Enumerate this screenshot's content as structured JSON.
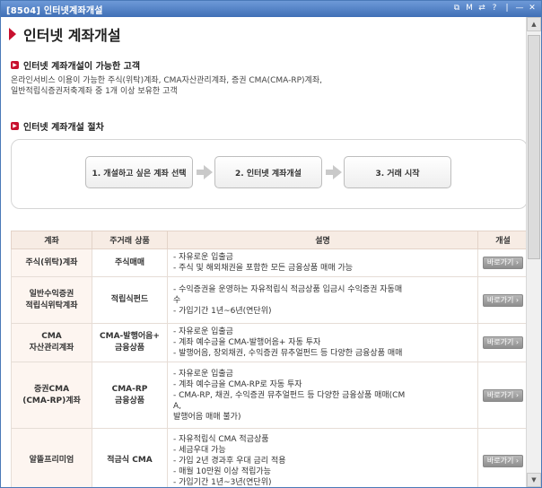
{
  "window": {
    "title": "[8504] 인터넷계좌개설",
    "controls": [
      "⧉",
      "M",
      "⇄",
      "?",
      "|",
      "—",
      "✕"
    ]
  },
  "page_title": "인터넷 계좌개설",
  "section_eligible": {
    "heading": "인터넷 계좌개설이 가능한 고객",
    "line1": "온라인서비스 이용이 가능한 주식(위탁)계좌, CMA자산관리계좌, 증권 CMA(CMA-RP)계좌,",
    "line2": "일반적립식증권저축계좌 중 1개 이상 보유한 고객"
  },
  "section_process": {
    "heading": "인터넷 계좌개설 절차",
    "steps": [
      "1. 개설하고 싶은 계좌 선택",
      "2. 인터넷 계좌개설",
      "3. 거래 시작"
    ]
  },
  "table": {
    "headers": [
      "계좌",
      "주거래 상품",
      "설명",
      "개설"
    ],
    "button_label": "바로가기 ›",
    "rows": [
      {
        "account": [
          "주식(위탁)계좌"
        ],
        "product": [
          "주식매매"
        ],
        "desc": [
          "- 자유로운 입출금",
          "- 주식 및 해외채권을 포함한 모든 금융상품 매매 가능"
        ]
      },
      {
        "account": [
          "일반수익증권",
          "적립식위탁계좌"
        ],
        "product": [
          "적립식펀드"
        ],
        "desc": [
          "- 수익증권을 운영하는 자유적립식 적금상품 입금시 수익증권 자동매",
          "수",
          "- 가입기간 1년~6년(연단위)"
        ]
      },
      {
        "account": [
          "CMA",
          "자산관리계좌"
        ],
        "product": [
          "CMA-발행어음+",
          "금융상품"
        ],
        "desc": [
          "- 자유로운 입출금",
          "- 계좌 예수금을 CMA-발행어음+ 자동 투자",
          "- 발행어음, 장외채권, 수익증권 뮤추얼펀드 등 다양한 금융상품 매매"
        ]
      },
      {
        "account": [
          "증권CMA",
          "(CMA-RP)계좌"
        ],
        "product": [
          "CMA-RP",
          "금융상품"
        ],
        "desc": [
          "- 자유로운 입출금",
          "- 계좌 예수금을 CMA-RP로 자동 투자",
          "- CMA-RP, 채권, 수익증권 뮤추얼펀드 등 다양한 금융상품 매매(CM",
          "A,",
          "발행어음 매매 불가)"
        ]
      },
      {
        "account": [
          "알뜰프리미엄"
        ],
        "product": [
          "적금식 CMA"
        ],
        "desc": [
          "- 자유적립식 CMA 적금상품",
          "- 세금우대 가능",
          "- 가입 2년 경과후 우대 금리 적용",
          "- 매월 10만원 이상 적립가능",
          "- 가입기간 1년~3년(연단위)"
        ]
      }
    ]
  },
  "colors": {
    "titlebar": "#3f6fb6",
    "accent_red": "#c8102e",
    "table_header_bg": "#f7ece4",
    "account_cell_bg": "#fdf5f0"
  }
}
